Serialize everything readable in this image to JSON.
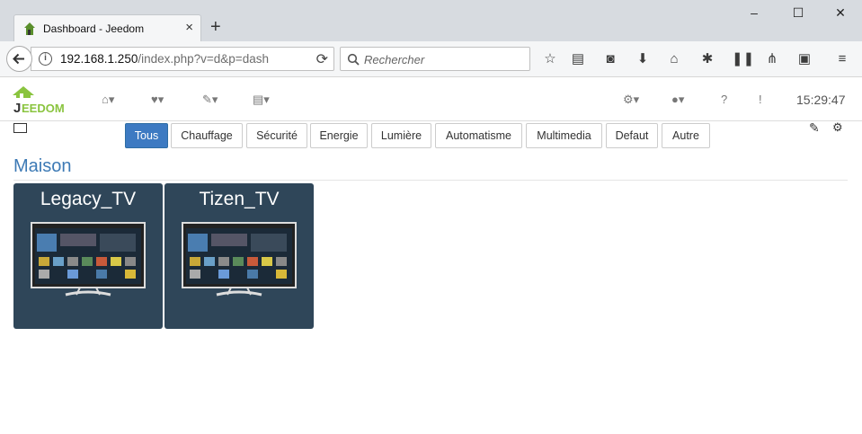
{
  "browser": {
    "tab_title": "Dashboard - Jeedom",
    "tab_close": "×",
    "new_tab": "+",
    "url_host": "192.168.1.250",
    "url_path": "/index.php?v=d&p=dash",
    "search_placeholder": "Rechercher",
    "window_controls": [
      "–",
      "☐",
      "✕"
    ]
  },
  "header": {
    "logo_text": "EEDOM",
    "logo_j": "J",
    "clock": "15:29:47"
  },
  "filters": {
    "items": [
      "Tous",
      "Chauffage",
      "Sécurité",
      "Energie",
      "Lumière",
      "Automatisme",
      "Multimedia",
      "Defaut",
      "Autre"
    ],
    "active": "Tous"
  },
  "room": {
    "title": "Maison"
  },
  "equipment": [
    {
      "name": "Legacy_TV"
    },
    {
      "name": "Tizen_TV"
    }
  ],
  "colors": {
    "accent": "#3d7ac2",
    "card_bg": "#2f4659",
    "room_title": "#3d7ab5",
    "logo_green": "#8ac43f"
  }
}
